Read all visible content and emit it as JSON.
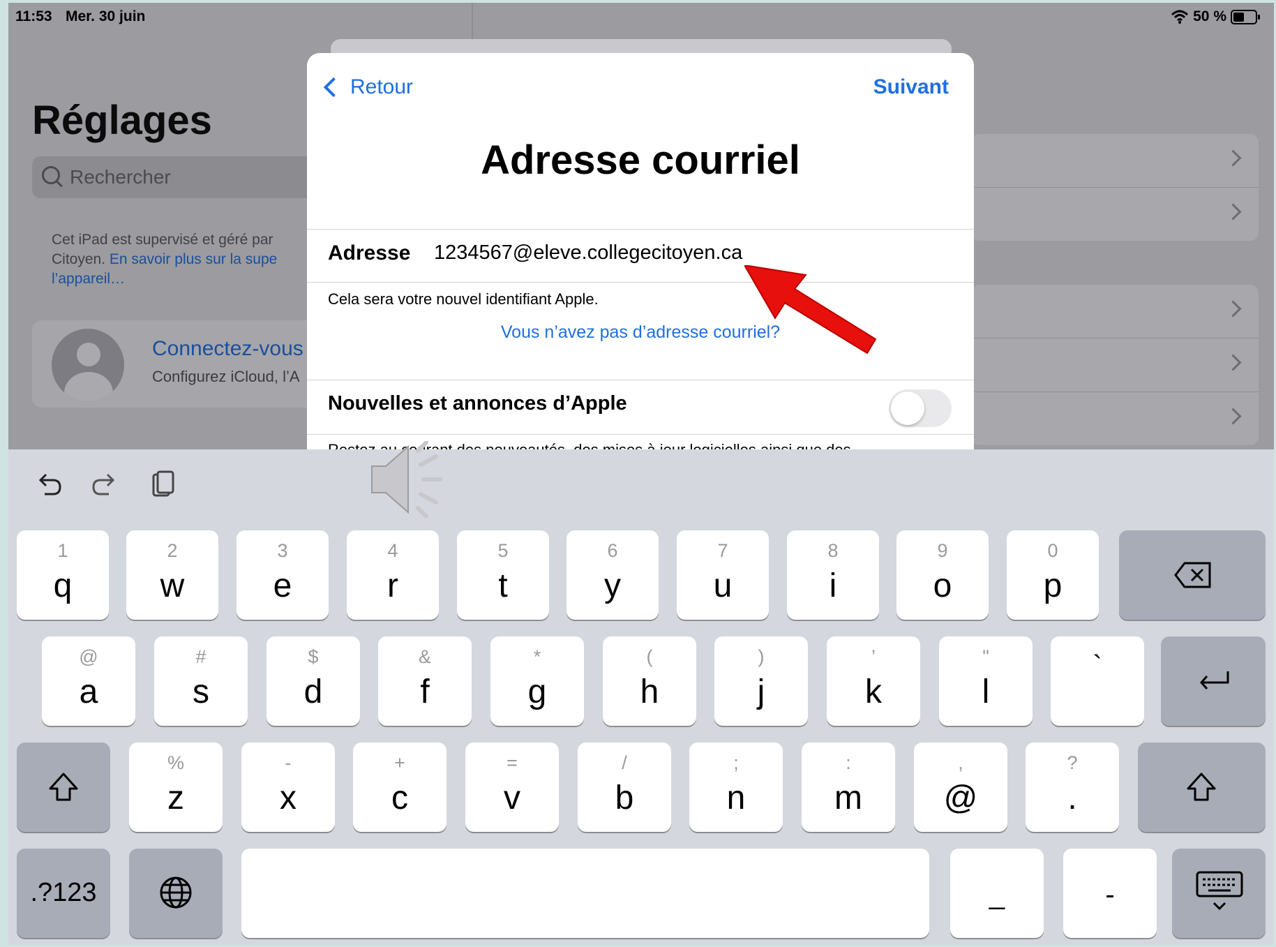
{
  "status_bar": {
    "time": "11:53",
    "date": "Mer. 30 juin",
    "battery": "50 %"
  },
  "settings": {
    "title": "Réglages",
    "search_placeholder": "Rechercher",
    "supervised_text": "Cet iPad est supervisé et géré par Citoyen.",
    "learn_more_link": "En savoir plus sur la supe l’appareil…",
    "account_name": "Connectez-vous",
    "account_sub": "Configurez iCloud, l’A"
  },
  "modal": {
    "back_label": "Retour",
    "next_label": "Suivant",
    "title": "Adresse courriel",
    "address_label": "Adresse",
    "address_value": "1234567@eleve.collegecitoyen.ca",
    "hint": "Cela sera votre nouvel identifiant Apple.",
    "no_email_link": "Vous n’avez pas d’adresse courriel?",
    "news_label": "Nouvelles et annonces d’Apple",
    "news_enabled": false,
    "cut_text": "Restez au courant des nouveautés, des mises à jour logicielles ainsi que des"
  },
  "keyboard": {
    "row1": [
      {
        "pri": "q",
        "sec": "1"
      },
      {
        "pri": "w",
        "sec": "2"
      },
      {
        "pri": "e",
        "sec": "3"
      },
      {
        "pri": "r",
        "sec": "4"
      },
      {
        "pri": "t",
        "sec": "5"
      },
      {
        "pri": "y",
        "sec": "6"
      },
      {
        "pri": "u",
        "sec": "7"
      },
      {
        "pri": "i",
        "sec": "8"
      },
      {
        "pri": "o",
        "sec": "9"
      },
      {
        "pri": "p",
        "sec": "0"
      }
    ],
    "row2": [
      {
        "pri": "a",
        "sec": "@"
      },
      {
        "pri": "s",
        "sec": "#"
      },
      {
        "pri": "d",
        "sec": "$"
      },
      {
        "pri": "f",
        "sec": "&"
      },
      {
        "pri": "g",
        "sec": "*"
      },
      {
        "pri": "h",
        "sec": "("
      },
      {
        "pri": "j",
        "sec": ")"
      },
      {
        "pri": "k",
        "sec": "’"
      },
      {
        "pri": "l",
        "sec": "\""
      },
      {
        "pri": "`",
        "sec": ""
      }
    ],
    "row3": [
      {
        "pri": "z",
        "sec": "%"
      },
      {
        "pri": "x",
        "sec": "-"
      },
      {
        "pri": "c",
        "sec": "+"
      },
      {
        "pri": "v",
        "sec": "="
      },
      {
        "pri": "b",
        "sec": "/"
      },
      {
        "pri": "n",
        "sec": ";"
      },
      {
        "pri": "m",
        "sec": ":"
      },
      {
        "pri": "@",
        "sec": ","
      },
      {
        "pri": ".",
        "sec": "?"
      }
    ],
    "numbers_label": ".?123",
    "underscore": "_",
    "dash": "-"
  },
  "icons": [
    "undo-icon",
    "redo-icon",
    "paste-icon",
    "backspace-icon",
    "return-icon",
    "shift-icon",
    "globe-icon",
    "keyboard-hide-icon",
    "speaker-icon",
    "wifi-icon",
    "battery-icon"
  ]
}
